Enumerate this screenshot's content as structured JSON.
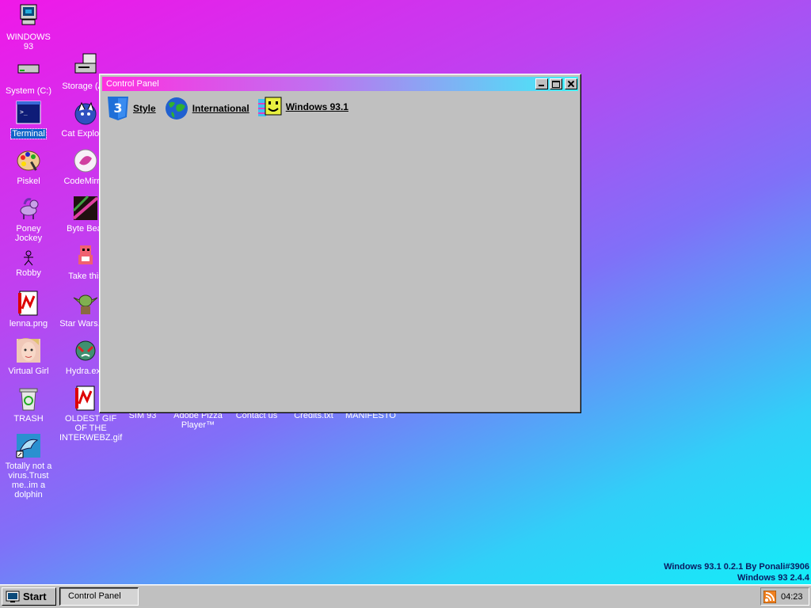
{
  "desktop": {
    "icons": [
      {
        "label": "WINDOWS 93"
      },
      {
        "label": "System (C:)"
      },
      {
        "label": "Storage (A:)"
      },
      {
        "label": "Terminal"
      },
      {
        "label": "Cat Explorer"
      },
      {
        "label": "Piskel"
      },
      {
        "label": "CodeMirror"
      },
      {
        "label": "Poney Jockey"
      },
      {
        "label": "Byte Beat"
      },
      {
        "label": "Robby"
      },
      {
        "label": "Take this"
      },
      {
        "label": "lenna.png"
      },
      {
        "label": "Star Wars.avi"
      },
      {
        "label": "Virtual Girl"
      },
      {
        "label": "Hydra.exe"
      },
      {
        "label": "TRASH"
      },
      {
        "label": "OLDEST GIF OF THE INTERWEBZ.gif"
      },
      {
        "label": "SIM 93"
      },
      {
        "label": "Adobe Pizza Player™"
      },
      {
        "label": "Contact us"
      },
      {
        "label": "Credits.txt"
      },
      {
        "label": "MANIFESTO"
      },
      {
        "label": "Totally not a virus.Trust me..im a dolphin"
      }
    ]
  },
  "window": {
    "title": "Control Panel",
    "items": [
      {
        "label": "Style",
        "icon": "css3-icon"
      },
      {
        "label": "International",
        "icon": "globe-icon"
      },
      {
        "label": "Windows 93.1",
        "icon": "smiley-icon"
      }
    ]
  },
  "version_lines": [
    "Windows 93.1 0.2.1 By Ponali#3906",
    "Windows 93 2.4.4"
  ],
  "taskbar": {
    "start_label": "Start",
    "tasks": [
      {
        "label": "Control Panel"
      }
    ],
    "clock": "04:23",
    "tray_icon": "rss-icon"
  },
  "colors": {
    "selection": "#1064c8",
    "face": "#c0c0c0",
    "version_text": "#0a1a60"
  }
}
